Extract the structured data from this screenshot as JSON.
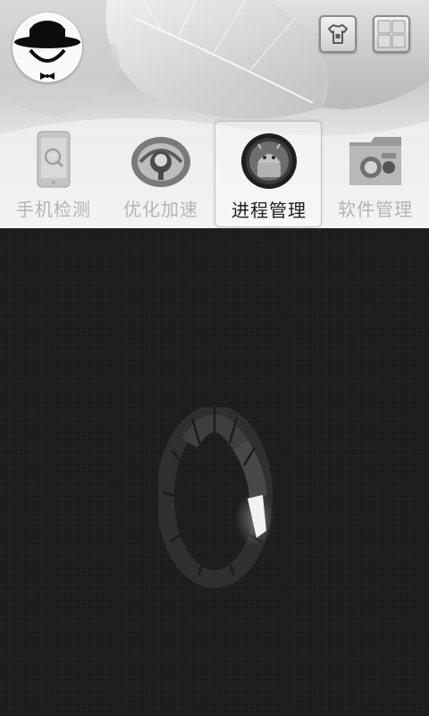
{
  "header": {
    "avatar_icon": "gentleman-hat-avatar-icon",
    "theme_button_icon": "tshirt-icon",
    "grid_button_icon": "grid-icon"
  },
  "tabs": [
    {
      "label": "手机检测",
      "icon": "phone-scan-icon",
      "active": false
    },
    {
      "label": "优化加速",
      "icon": "speed-turbine-icon",
      "active": false
    },
    {
      "label": "进程管理",
      "icon": "process-android-gear-icon",
      "active": true
    },
    {
      "label": "软件管理",
      "icon": "software-safe-icon",
      "active": false
    }
  ],
  "main": {
    "loading_indicator": "loading-spinner-icon"
  },
  "colors": {
    "main_background": "#1c1c1c",
    "tab_inactive": "#b4b4b4",
    "tab_active": "#1e1e1e"
  }
}
